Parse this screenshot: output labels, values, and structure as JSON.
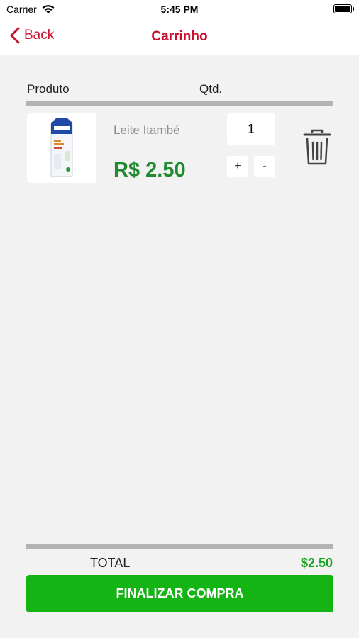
{
  "status_bar": {
    "carrier": "Carrier",
    "time": "5:45 PM"
  },
  "nav": {
    "back_label": "Back",
    "title": "Carrinho"
  },
  "columns": {
    "product": "Produto",
    "qty": "Qtd."
  },
  "cart_items": [
    {
      "name": "Leite Itambé",
      "price": "R$ 2.50",
      "quantity": "1",
      "plus_label": "+",
      "minus_label": "-"
    }
  ],
  "summary": {
    "total_label": "TOTAL",
    "total_value": "$2.50"
  },
  "checkout_label": "FINALIZAR COMPRA",
  "colors": {
    "accent_red": "#c8102e",
    "price_green": "#1f8a2e",
    "button_green": "#14b414"
  }
}
